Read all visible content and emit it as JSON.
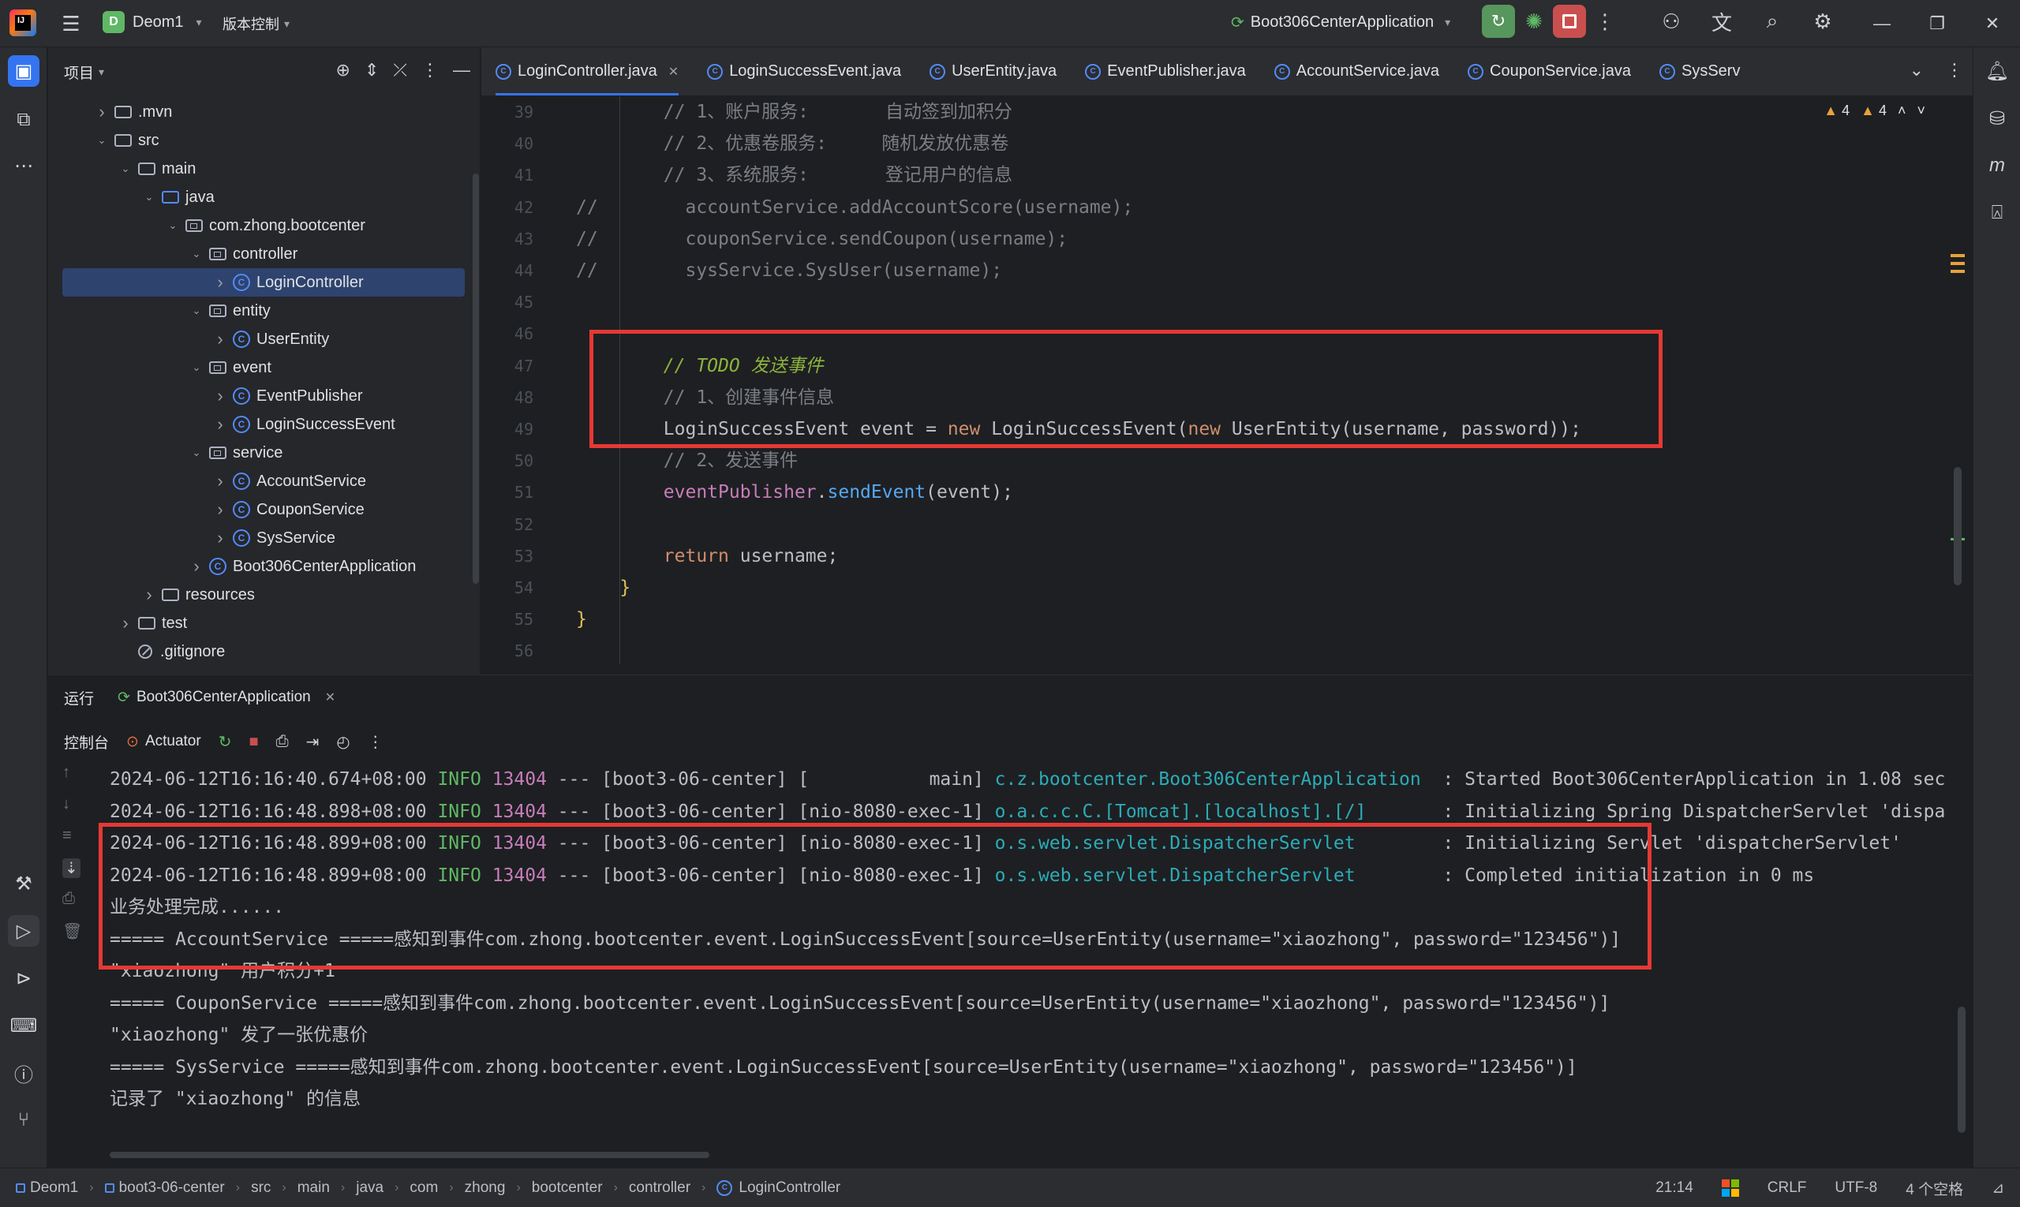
{
  "titlebar": {
    "project_badge": "D",
    "project_name": "Deom1",
    "vcs_label": "版本控制",
    "run_config": "Boot306CenterApplication"
  },
  "project_panel": {
    "title": "项目",
    "tree": [
      {
        "label": ".mvn",
        "type": "folder",
        "depth": 1,
        "expanded": false
      },
      {
        "label": "src",
        "type": "folder",
        "depth": 1,
        "expanded": true
      },
      {
        "label": "main",
        "type": "folder",
        "depth": 2,
        "expanded": true
      },
      {
        "label": "java",
        "type": "folder-src",
        "depth": 3,
        "expanded": true
      },
      {
        "label": "com.zhong.bootcenter",
        "type": "package",
        "depth": 4,
        "expanded": true
      },
      {
        "label": "controller",
        "type": "package",
        "depth": 5,
        "expanded": true
      },
      {
        "label": "LoginController",
        "type": "class",
        "depth": 6,
        "expanded": false,
        "selected": true
      },
      {
        "label": "entity",
        "type": "package",
        "depth": 5,
        "expanded": true
      },
      {
        "label": "UserEntity",
        "type": "class",
        "depth": 6,
        "expanded": false
      },
      {
        "label": "event",
        "type": "package",
        "depth": 5,
        "expanded": true
      },
      {
        "label": "EventPublisher",
        "type": "class",
        "depth": 6,
        "expanded": false
      },
      {
        "label": "LoginSuccessEvent",
        "type": "class",
        "depth": 6,
        "expanded": false
      },
      {
        "label": "service",
        "type": "package",
        "depth": 5,
        "expanded": true
      },
      {
        "label": "AccountService",
        "type": "class",
        "depth": 6,
        "expanded": false
      },
      {
        "label": "CouponService",
        "type": "class",
        "depth": 6,
        "expanded": false
      },
      {
        "label": "SysService",
        "type": "class",
        "depth": 6,
        "expanded": false
      },
      {
        "label": "Boot306CenterApplication",
        "type": "spring-class",
        "depth": 5,
        "expanded": false
      },
      {
        "label": "resources",
        "type": "folder-res",
        "depth": 3,
        "expanded": false
      },
      {
        "label": "test",
        "type": "folder",
        "depth": 2,
        "expanded": false
      },
      {
        "label": ".gitignore",
        "type": "git",
        "depth": 2,
        "expanded": null
      }
    ]
  },
  "editor": {
    "tabs": [
      {
        "label": "LoginController.java",
        "active": true
      },
      {
        "label": "LoginSuccessEvent.java",
        "active": false
      },
      {
        "label": "UserEntity.java",
        "active": false
      },
      {
        "label": "EventPublisher.java",
        "active": false
      },
      {
        "label": "AccountService.java",
        "active": false
      },
      {
        "label": "CouponService.java",
        "active": false
      },
      {
        "label": "SysServ",
        "active": false
      }
    ],
    "warnings": "4",
    "weak_warnings": "4",
    "lines": [
      {
        "n": "39",
        "html": "        <span class='c-com'>// 1、账户服务:       自动签到加积分</span>"
      },
      {
        "n": "40",
        "html": "        <span class='c-com'>// 2、优惠卷服务:     随机发放优惠卷</span>"
      },
      {
        "n": "41",
        "html": "        <span class='c-com'>// 3、系统服务:       登记用户的信息</span>"
      },
      {
        "n": "42",
        "html": "<span class='c-com'>//        accountService.addAccountScore(username);</span>"
      },
      {
        "n": "43",
        "html": "<span class='c-com'>//        couponService.sendCoupon(username);</span>"
      },
      {
        "n": "44",
        "html": "<span class='c-com'>//        sysService.SysUser(username);</span>"
      },
      {
        "n": "45",
        "html": ""
      },
      {
        "n": "46",
        "html": ""
      },
      {
        "n": "47",
        "html": "        <span class='c-todo'>// TODO 发送事件</span>"
      },
      {
        "n": "48",
        "html": "        <span class='c-com'>// 1、创建事件信息</span>"
      },
      {
        "n": "49",
        "html": "        LoginSuccessEvent event = <span class='c-kw'>new</span> LoginSuccessEvent(<span class='c-kw'>new</span> UserEntity(username, password));"
      },
      {
        "n": "50",
        "html": "        <span class='c-com'>// 2、发送事件</span>"
      },
      {
        "n": "51",
        "html": "        <span class='c-field'>eventPublisher</span>.<span class='c-fn'>sendEvent</span>(event);"
      },
      {
        "n": "52",
        "html": ""
      },
      {
        "n": "53",
        "html": "        <span class='c-kw'>return</span> username;"
      },
      {
        "n": "54",
        "html": "    <span class='c-brace'>}</span>"
      },
      {
        "n": "55",
        "html": "<span class='c-brace'>}</span>"
      },
      {
        "n": "56",
        "html": ""
      }
    ]
  },
  "run_panel": {
    "title": "运行",
    "tab_label": "Boot306CenterApplication",
    "console_label": "控制台",
    "actuator_label": "Actuator",
    "log_lines": [
      {
        "ts": "2024-06-12T16:16:40.674+08:00",
        "level": "INFO",
        "pid": "13404",
        "mid": " --- [boot3-06-center] [           main] ",
        "cls": "c.z.bootcenter.Boot306CenterApplication ",
        "msg": " : Started Boot306CenterApplication in 1.08 sec"
      },
      {
        "ts": "2024-06-12T16:16:48.898+08:00",
        "level": "INFO",
        "pid": "13404",
        "mid": " --- [boot3-06-center] [nio-8080-exec-1] ",
        "cls": "o.a.c.c.C.[Tomcat].[localhost].[/]      ",
        "msg": " : Initializing Spring DispatcherServlet 'dispa"
      },
      {
        "ts": "2024-06-12T16:16:48.899+08:00",
        "level": "INFO",
        "pid": "13404",
        "mid": " --- [boot3-06-center] [nio-8080-exec-1] ",
        "cls": "o.s.web.servlet.DispatcherServlet       ",
        "msg": " : Initializing Servlet 'dispatcherServlet'"
      },
      {
        "ts": "2024-06-12T16:16:48.899+08:00",
        "level": "INFO",
        "pid": "13404",
        "mid": " --- [boot3-06-center] [nio-8080-exec-1] ",
        "cls": "o.s.web.servlet.DispatcherServlet       ",
        "msg": " : Completed initialization in 0 ms"
      }
    ],
    "output_lines": [
      "业务处理完成......",
      "===== AccountService =====感知到事件com.zhong.bootcenter.event.LoginSuccessEvent[source=UserEntity(username=\"xiaozhong\", password=\"123456\")]",
      "\"xiaozhong\" 用户积分+1",
      "===== CouponService =====感知到事件com.zhong.bootcenter.event.LoginSuccessEvent[source=UserEntity(username=\"xiaozhong\", password=\"123456\")]",
      "\"xiaozhong\" 发了一张优惠价",
      "===== SysService =====感知到事件com.zhong.bootcenter.event.LoginSuccessEvent[source=UserEntity(username=\"xiaozhong\", password=\"123456\")]",
      "记录了 \"xiaozhong\" 的信息"
    ]
  },
  "statusbar": {
    "breadcrumb": [
      "Deom1",
      "boot3-06-center",
      "src",
      "main",
      "java",
      "com",
      "zhong",
      "bootcenter",
      "controller",
      "LoginController"
    ],
    "position": "21:14",
    "line_sep": "CRLF",
    "encoding": "UTF-8",
    "indent": "4 个空格"
  },
  "colors": {
    "highlight_box": "#e53935",
    "accent": "#3574f0",
    "run_green": "#57965c",
    "stop_red": "#c94f4f"
  }
}
